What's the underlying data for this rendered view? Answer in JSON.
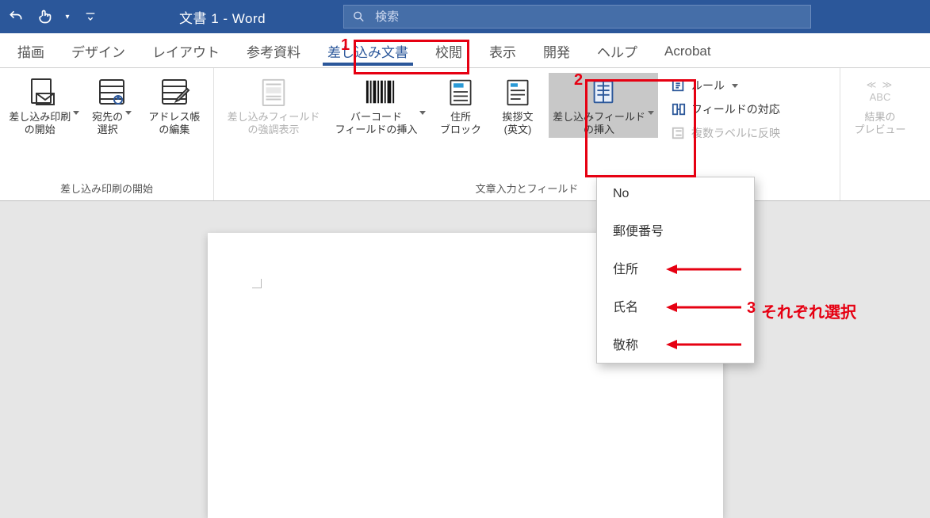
{
  "titlebar": {
    "doc_title": "文書 1  -  Word",
    "search_placeholder": "検索"
  },
  "tabs": {
    "draw": "描画",
    "design": "デザイン",
    "layout": "レイアウト",
    "references": "参考資料",
    "mailings": "差し込み文書",
    "review": "校閲",
    "view": "表示",
    "developer": "開発",
    "help": "ヘルプ",
    "acrobat": "Acrobat"
  },
  "ribbon": {
    "group1": {
      "label": "差し込み印刷の開始",
      "start_merge": "差し込み印刷\nの開始",
      "select_recipients": "宛先の\n選択",
      "edit_addrbook": "アドレス帳\nの編集"
    },
    "group2": {
      "label": "文章入力とフィールド",
      "highlight_fields": "差し込みフィールド\nの強調表示",
      "barcode": "バーコード\nフィールドの挿入",
      "address_block": "住所\nブロック",
      "greeting": "挨拶文\n(英文)",
      "insert_field": "差し込みフィールド\nの挿入",
      "rules": "ルール",
      "match_fields": "フィールドの対応",
      "update_labels": "複数ラベルに反映"
    },
    "group3": {
      "abc": "ABC",
      "preview": "結果の\nプレビュー"
    }
  },
  "dropdown": {
    "items": [
      "No",
      "郵便番号",
      "住所",
      "氏名",
      "敬称"
    ]
  },
  "annotations": {
    "num1": "1",
    "num2": "2",
    "num3": "3",
    "text3": "それぞれ選択"
  },
  "colors": {
    "brand": "#2b579a",
    "annotation": "#e60012"
  }
}
